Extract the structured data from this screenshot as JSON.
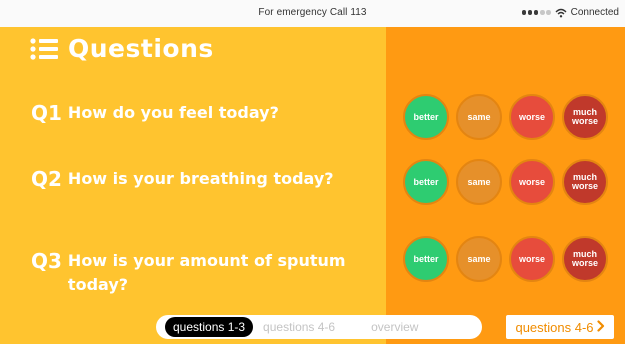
{
  "status_bar": {
    "emergency_text": "For emergency Call 113",
    "signal_bars_on": 3,
    "signal_bars_total": 5,
    "connection_text": "Connected"
  },
  "header": {
    "title": "Questions",
    "icon": "list-icon"
  },
  "questions": [
    {
      "number": "Q1",
      "text": "How do you feel today?"
    },
    {
      "number": "Q2",
      "text": "How is your breathing today?"
    },
    {
      "number": "Q3",
      "text": "How is your amount of sputum today?"
    }
  ],
  "answers": {
    "better": "better",
    "same": "same",
    "worse": "worse",
    "much_worse_line1": "much",
    "much_worse_line2": "worse"
  },
  "pagination": {
    "items": [
      "questions 1-3",
      "questions 4-6",
      "overview"
    ],
    "active_index": 0
  },
  "next_button": {
    "label": "questions 4-6",
    "icon": "chevron-right-icon"
  },
  "colors": {
    "left_panel": "#ffc42f",
    "right_panel": "#ff9a12",
    "better": "#2ecc71",
    "same": "#e6902a",
    "worse": "#e74c3c",
    "much_worse": "#c0392b"
  }
}
